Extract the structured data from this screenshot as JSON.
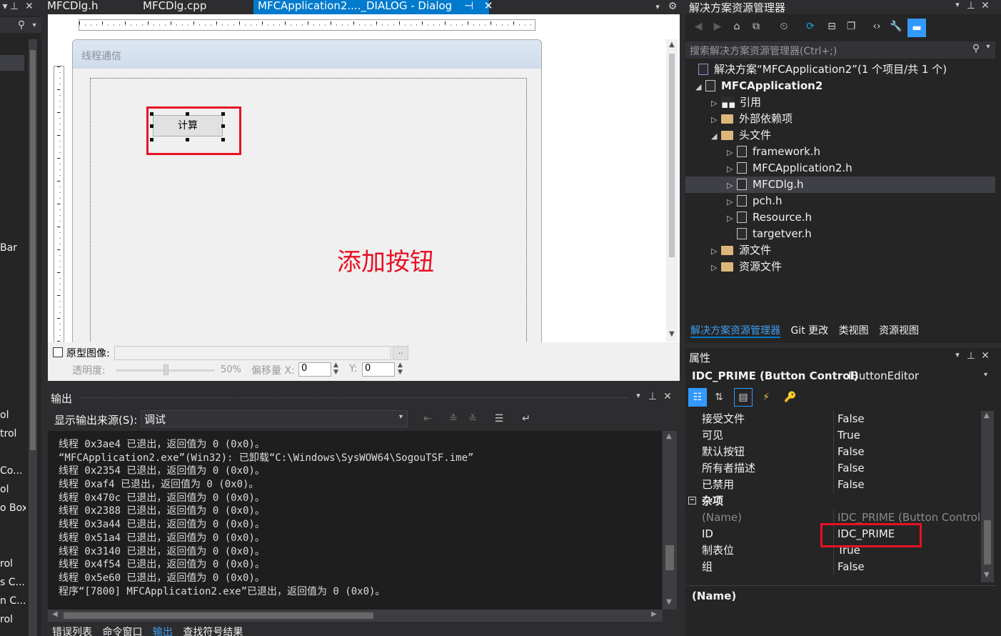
{
  "toolbox": {
    "labels": [
      "Bar",
      "ol",
      "trol",
      "Co...",
      "ol",
      "o Box",
      "rol",
      "s C...",
      "n C...",
      "rol"
    ]
  },
  "tabs": {
    "tab1": "MFCDlg.h",
    "tab2": "MFCDlg.cpp",
    "tab3": "MFCApplication2...._DIALOG - Dialog"
  },
  "designer": {
    "dialog_title": "线程通信",
    "button_label": "计算",
    "annotation": "添加按钮",
    "proto_label": "原型图像:",
    "proto_browse": "..",
    "opacity_label": "透明度:",
    "opacity_value": "50%",
    "offset_label": "偏移量 X:",
    "x_value": "0",
    "y_label": "Y:",
    "y_value": "0"
  },
  "output": {
    "title": "输出",
    "source_label": "显示输出来源(S):",
    "source_value": "调试",
    "lines": [
      "线程 0x3ae4 已退出，返回值为 0 (0x0)。",
      "“MFCApplication2.exe”(Win32): 已卸载“C:\\Windows\\SysWOW64\\SogouTSF.ime”",
      "线程 0x2354 已退出，返回值为 0 (0x0)。",
      "线程 0xaf4 已退出，返回值为 0 (0x0)。",
      "线程 0x470c 已退出，返回值为 0 (0x0)。",
      "线程 0x2388 已退出，返回值为 0 (0x0)。",
      "线程 0x3a44 已退出，返回值为 0 (0x0)。",
      "线程 0x51a4 已退出，返回值为 0 (0x0)。",
      "线程 0x3140 已退出，返回值为 0 (0x0)。",
      "线程 0x4f54 已退出，返回值为 0 (0x0)。",
      "线程 0x5e60 已退出，返回值为 0 (0x0)。",
      "程序“[7800] MFCApplication2.exe”已退出，返回值为 0 (0x0)。"
    ],
    "bottom_tabs": [
      "错误列表",
      "命令窗口",
      "输出",
      "查找符号结果"
    ]
  },
  "solution": {
    "title": "解决方案资源管理器",
    "search_placeholder": "搜索解决方案资源管理器(Ctrl+;)",
    "tree": [
      {
        "label": "解决方案“MFCApplication2”(1 个项目/共 1 个)"
      },
      {
        "label": "MFCApplication2"
      },
      {
        "label": "引用"
      },
      {
        "label": "外部依赖项"
      },
      {
        "label": "头文件"
      },
      {
        "label": "framework.h"
      },
      {
        "label": "MFCApplication2.h"
      },
      {
        "label": "MFCDlg.h"
      },
      {
        "label": "pch.h"
      },
      {
        "label": "Resource.h"
      },
      {
        "label": "targetver.h"
      },
      {
        "label": "源文件"
      },
      {
        "label": "资源文件"
      }
    ],
    "bottom_tabs": [
      "解决方案资源管理器",
      "Git 更改",
      "类视图",
      "资源视图"
    ]
  },
  "properties": {
    "title": "属性",
    "object_bold": "IDC_PRIME (Button Control)",
    "object_type": "IButtonEditor",
    "rows": [
      {
        "name": "接受文件",
        "value": "False"
      },
      {
        "name": "可见",
        "value": "True"
      },
      {
        "name": "默认按钮",
        "value": "False"
      },
      {
        "name": "所有者描述",
        "value": "False"
      },
      {
        "name": "已禁用",
        "value": "False"
      }
    ],
    "category": "杂项",
    "rows2": [
      {
        "name": "(Name)",
        "value": "IDC_PRIME (Button Control)"
      },
      {
        "name": "ID",
        "value": "IDC_PRIME"
      },
      {
        "name": "制表位",
        "value": "True"
      },
      {
        "name": "组",
        "value": "False"
      }
    ],
    "description_title": "(Name)"
  },
  "colors": {
    "accent": "#007acc",
    "annotation_red": "#e81123"
  }
}
